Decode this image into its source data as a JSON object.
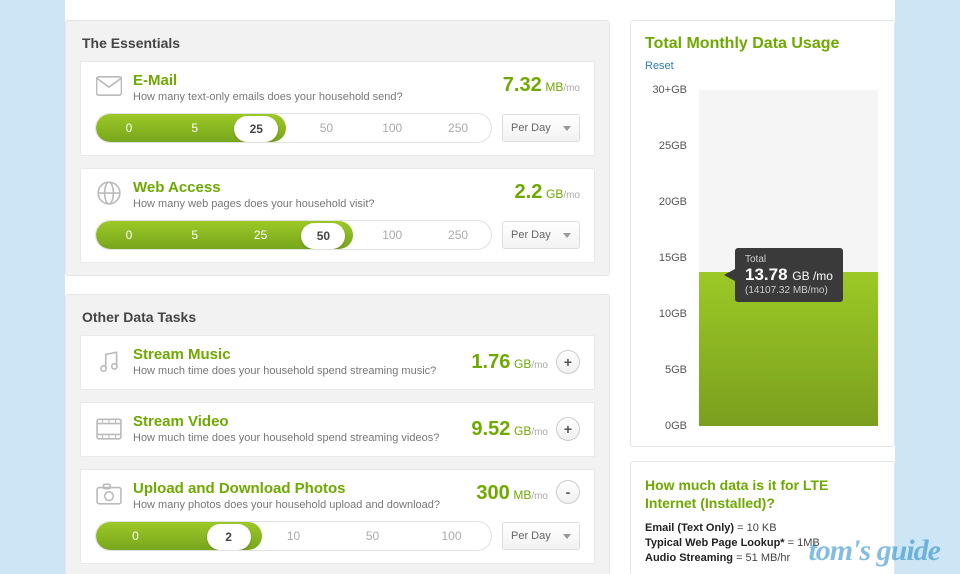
{
  "essentials": {
    "title": "The Essentials",
    "email": {
      "title": "E-Mail",
      "sub": "How many text-only emails does your household send?",
      "value": "7.32",
      "unit": "MB",
      "per": "/mo",
      "slider": {
        "options": [
          "0",
          "5",
          "25",
          "50",
          "100",
          "250"
        ],
        "selectedIndex": 2,
        "fillPct": 48,
        "thumbLeftPct": 35
      },
      "freq": "Per Day"
    },
    "web": {
      "title": "Web Access",
      "sub": "How many web pages does your household visit?",
      "value": "2.2",
      "unit": "GB",
      "per": "/mo",
      "slider": {
        "options": [
          "0",
          "5",
          "25",
          "50",
          "100",
          "250"
        ],
        "selectedIndex": 3,
        "fillPct": 65,
        "thumbLeftPct": 52
      },
      "freq": "Per Day"
    }
  },
  "other": {
    "title": "Other Data Tasks",
    "music": {
      "title": "Stream Music",
      "sub": "How much time does your household spend streaming music?",
      "value": "1.76",
      "unit": "GB",
      "per": "/mo",
      "expanded": false,
      "expandLabel": "+"
    },
    "video": {
      "title": "Stream Video",
      "sub": "How much time does your household spend streaming videos?",
      "value": "9.52",
      "unit": "GB",
      "per": "/mo",
      "expanded": false,
      "expandLabel": "+"
    },
    "photos": {
      "title": "Upload and Download Photos",
      "sub": "How many photos does your household upload and download?",
      "value": "300",
      "unit": "MB",
      "per": "/mo",
      "expanded": true,
      "expandLabel": "-",
      "slider": {
        "options": [
          "0",
          "2",
          "10",
          "50",
          "100"
        ],
        "selectedIndex": 1,
        "fillPct": 42,
        "thumbLeftPct": 28
      },
      "freq": "Per Day"
    }
  },
  "usage": {
    "title": "Total Monthly Data Usage",
    "reset": "Reset",
    "ticks": [
      "30+GB",
      "25GB",
      "20GB",
      "15GB",
      "10GB",
      "5GB",
      "0GB"
    ],
    "barHeightPct": 45.9,
    "tooltip": {
      "label": "Total",
      "mainValue": "13.78",
      "mainUnit": "GB /mo",
      "sub": "(14107.32 MB/mo)"
    }
  },
  "info": {
    "title": "How much data is it for LTE Internet (Installed)?",
    "rows": [
      {
        "label": "Email (Text Only)",
        "value": " = 10 KB"
      },
      {
        "label": "Typical Web Page Lookup*",
        "value": " = 1MB"
      },
      {
        "label": "Audio Streaming",
        "value": " = 51 MB/hr"
      }
    ]
  },
  "chart_data": {
    "type": "bar",
    "categories": [
      "Total Monthly Data Usage"
    ],
    "values": [
      13.78
    ],
    "ylabel": "GB",
    "ylim": [
      0,
      30
    ],
    "ticks": [
      0,
      5,
      10,
      15,
      20,
      25,
      30
    ]
  },
  "watermark": "tom's guide"
}
